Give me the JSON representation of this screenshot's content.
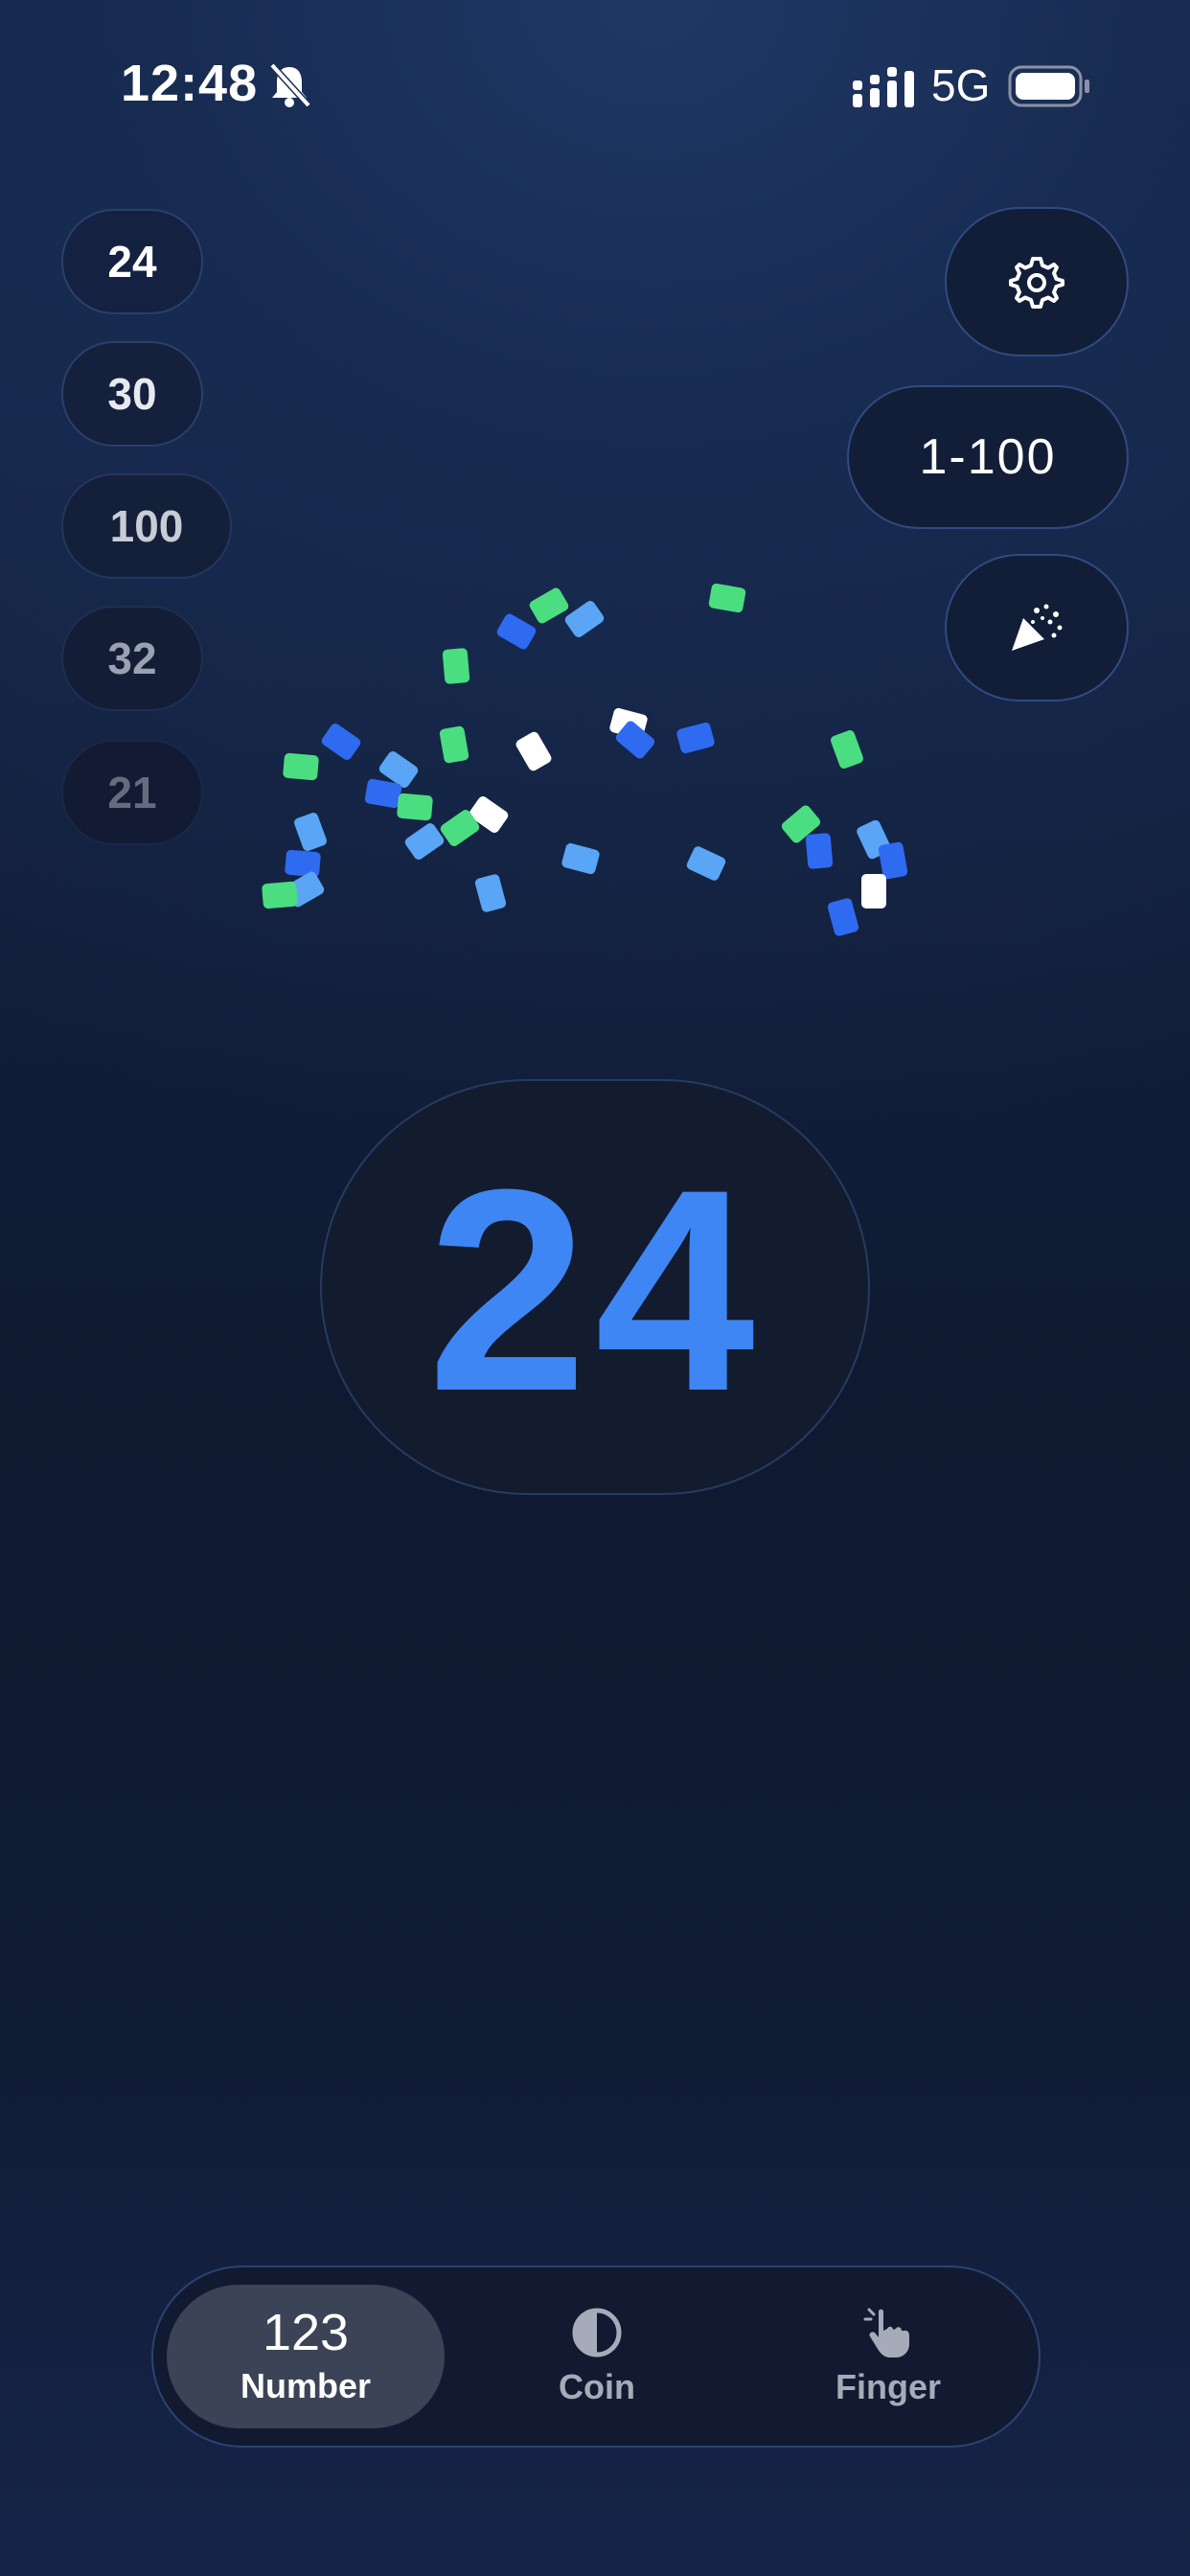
{
  "status_bar": {
    "time": "12:48",
    "network": "5G",
    "icons": [
      "bell-slash-icon",
      "signal-icon",
      "battery-icon"
    ]
  },
  "history": [
    "24",
    "30",
    "100",
    "32",
    "21"
  ],
  "controls": {
    "settings_icon": "gear-icon",
    "range_label": "1-100",
    "confetti_icon": "party-popper-icon"
  },
  "result": {
    "value": "24",
    "color": "#3f86f5"
  },
  "tabs": [
    {
      "glyph": "123",
      "label": "Number",
      "icon": "number-glyph",
      "selected": true
    },
    {
      "glyph": "",
      "label": "Coin",
      "icon": "half-circle-icon",
      "selected": false
    },
    {
      "glyph": "",
      "label": "Finger",
      "icon": "pointing-hand-icon",
      "selected": false
    }
  ],
  "colors": {
    "accent": "#3f86f5",
    "confetti": [
      "#4ade80",
      "#2f6bf0",
      "#5aa5f5",
      "#ffffff"
    ]
  }
}
